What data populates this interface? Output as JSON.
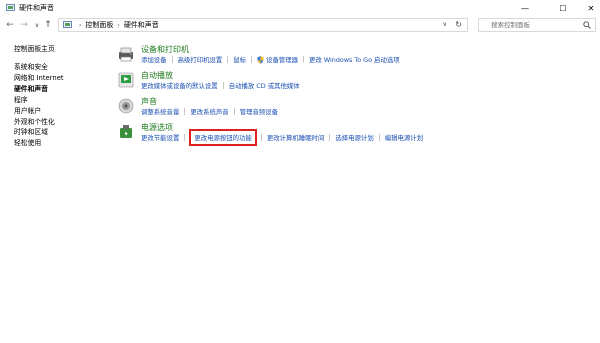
{
  "window": {
    "title": "硬件和声音",
    "controls": {
      "minimize": "—",
      "maximize": "☐",
      "close": "✕"
    }
  },
  "nav": {
    "back": "←",
    "forward": "→",
    "dropdown": "∨",
    "up": "↑"
  },
  "address": {
    "crumbs": [
      "控制面板",
      "硬件和声音"
    ],
    "separator": "›",
    "dropdown": "∨",
    "refresh": "↻"
  },
  "search": {
    "placeholder": "搜索控制面板"
  },
  "sidebar": {
    "home": "控制面板主页",
    "items": [
      {
        "label": "系统和安全",
        "current": false
      },
      {
        "label": "网络和 Internet",
        "current": false
      },
      {
        "label": "硬件和声音",
        "current": true
      },
      {
        "label": "程序",
        "current": false
      },
      {
        "label": "用户帐户",
        "current": false
      },
      {
        "label": "外观和个性化",
        "current": false
      },
      {
        "label": "时钟和区域",
        "current": false
      },
      {
        "label": "轻松使用",
        "current": false
      }
    ]
  },
  "categories": [
    {
      "title": "设备和打印机",
      "icon": "printer-icon",
      "links": [
        "添加设备",
        "高级打印机设置",
        "鼠标",
        "设备管理器",
        "更改 Windows To Go 启动选项"
      ]
    },
    {
      "title": "自动播放",
      "icon": "autoplay-icon",
      "links": [
        "更改媒体或设备的默认设置",
        "自动播放 CD 或其他媒体"
      ]
    },
    {
      "title": "声音",
      "icon": "speaker-icon",
      "links": [
        "调整系统音量",
        "更改系统声音",
        "管理音频设备"
      ]
    },
    {
      "title": "电源选项",
      "icon": "power-options-icon",
      "links": [
        "更改节能设置",
        "更改电源按钮的功能",
        "更改计算机睡眠时间",
        "选择电源计划",
        "编辑电源计划"
      ]
    }
  ],
  "colors": {
    "category_title": "#1e7b1e",
    "link": "#1a4fb4",
    "highlight_border": "#e02020"
  }
}
